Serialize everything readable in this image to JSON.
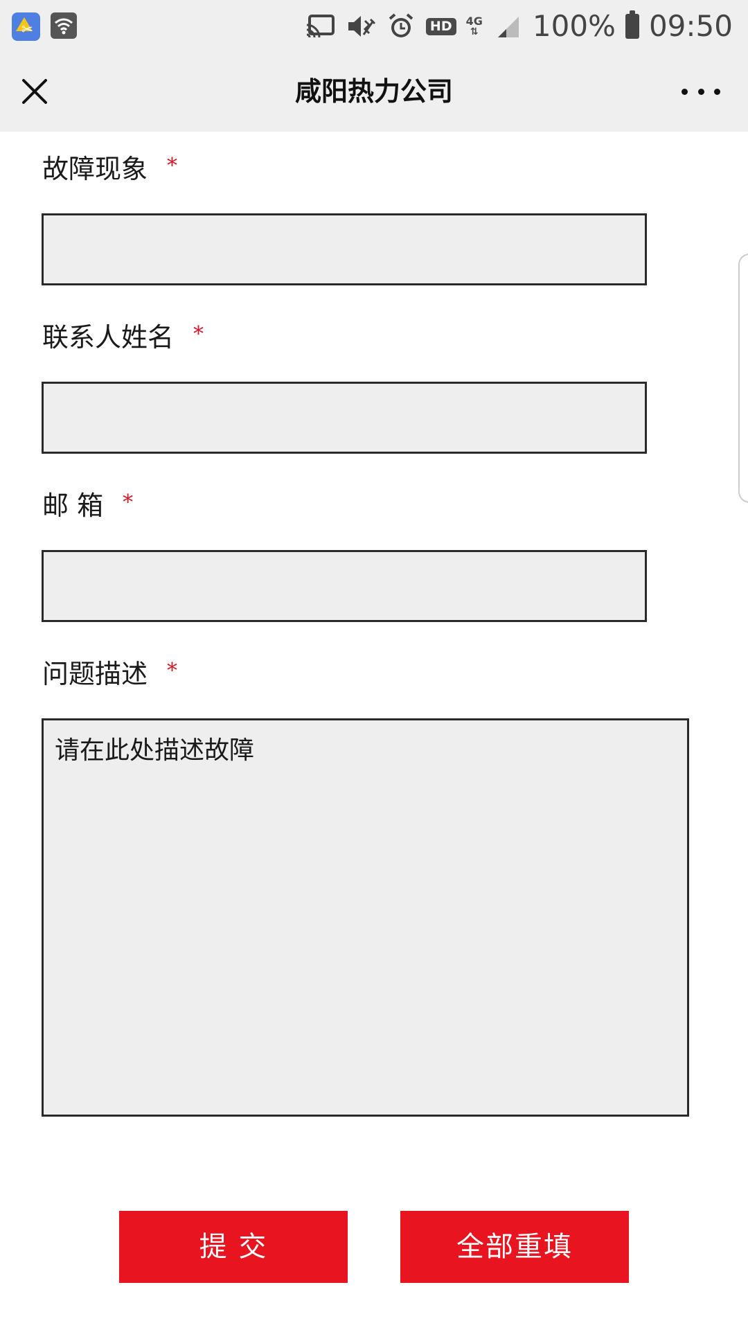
{
  "status_bar": {
    "icons": [
      "screenshot-app-icon",
      "wifi-icon",
      "cast-icon",
      "vibrate-icon",
      "alarm-icon",
      "hd-icon",
      "network-4g-icon",
      "signal-icon",
      "battery-icon"
    ],
    "hd": "HD",
    "network": "4G",
    "battery_percent": "100%",
    "time": "09:50"
  },
  "header": {
    "title": "咸阳热力公司",
    "left_icon": "close-icon",
    "right_icon": "more-icon"
  },
  "form": {
    "required_mark": "*",
    "fields": [
      {
        "label": "故障现象",
        "value": ""
      },
      {
        "label": "联系人姓名",
        "value": ""
      },
      {
        "label": "邮 箱",
        "value": ""
      }
    ],
    "description": {
      "label": "问题描述",
      "placeholder": "请在此处描述故障",
      "value": ""
    }
  },
  "buttons": {
    "submit": "提 交",
    "reset": "全部重填"
  },
  "colors": {
    "accent": "#e8141f",
    "required": "#d01c2a",
    "bar_background": "#efefef",
    "input_background": "#eeeeee"
  }
}
